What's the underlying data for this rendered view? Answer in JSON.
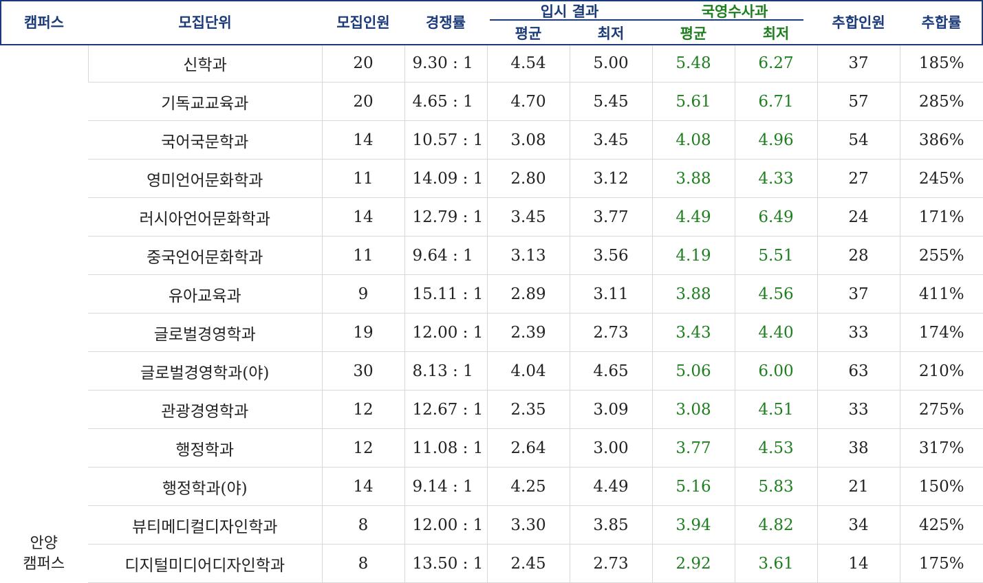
{
  "header": {
    "campus": "캠퍼스",
    "unit": "모집단위",
    "quota": "모집인원",
    "competition": "경쟁률",
    "admission_result": "입시 결과",
    "kems": "국영수사과",
    "avg": "평균",
    "min": "최저",
    "extra": "추합인원",
    "extra_rate": "추합률"
  },
  "campus": {
    "line1": "안양",
    "line2": "캠퍼스"
  },
  "rows": [
    {
      "unit": "신학과",
      "quota": "20",
      "competition": "9.30 : 1",
      "avg": "4.54",
      "min": "5.00",
      "k_avg": "5.48",
      "k_min": "6.27",
      "extra": "37",
      "rate": "185%"
    },
    {
      "unit": "기독교교육과",
      "quota": "20",
      "competition": "4.65 : 1",
      "avg": "4.70",
      "min": "5.45",
      "k_avg": "5.61",
      "k_min": "6.71",
      "extra": "57",
      "rate": "285%"
    },
    {
      "unit": "국어국문학과",
      "quota": "14",
      "competition": "10.57 : 1",
      "avg": "3.08",
      "min": "3.45",
      "k_avg": "4.08",
      "k_min": "4.96",
      "extra": "54",
      "rate": "386%"
    },
    {
      "unit": "영미언어문화학과",
      "quota": "11",
      "competition": "14.09 : 1",
      "avg": "2.80",
      "min": "3.12",
      "k_avg": "3.88",
      "k_min": "4.33",
      "extra": "27",
      "rate": "245%"
    },
    {
      "unit": "러시아언어문화학과",
      "quota": "14",
      "competition": "12.79 : 1",
      "avg": "3.45",
      "min": "3.77",
      "k_avg": "4.49",
      "k_min": "6.49",
      "extra": "24",
      "rate": "171%"
    },
    {
      "unit": "중국언어문화학과",
      "quota": "11",
      "competition": "9.64 : 1",
      "avg": "3.13",
      "min": "3.56",
      "k_avg": "4.19",
      "k_min": "5.51",
      "extra": "28",
      "rate": "255%"
    },
    {
      "unit": "유아교육과",
      "quota": "9",
      "competition": "15.11 : 1",
      "avg": "2.89",
      "min": "3.11",
      "k_avg": "3.88",
      "k_min": "4.56",
      "extra": "37",
      "rate": "411%"
    },
    {
      "unit": "글로벌경영학과",
      "quota": "19",
      "competition": "12.00 : 1",
      "avg": "2.39",
      "min": "2.73",
      "k_avg": "3.43",
      "k_min": "4.40",
      "extra": "33",
      "rate": "174%"
    },
    {
      "unit": "글로벌경영학과(야)",
      "quota": "30",
      "competition": "8.13 : 1",
      "avg": "4.04",
      "min": "4.65",
      "k_avg": "5.06",
      "k_min": "6.00",
      "extra": "63",
      "rate": "210%"
    },
    {
      "unit": "관광경영학과",
      "quota": "12",
      "competition": "12.67 : 1",
      "avg": "2.35",
      "min": "3.09",
      "k_avg": "3.08",
      "k_min": "4.51",
      "extra": "33",
      "rate": "275%"
    },
    {
      "unit": "행정학과",
      "quota": "12",
      "competition": "11.08 : 1",
      "avg": "2.64",
      "min": "3.00",
      "k_avg": "3.77",
      "k_min": "4.53",
      "extra": "38",
      "rate": "317%"
    },
    {
      "unit": "행정학과(야)",
      "quota": "14",
      "competition": "9.14 : 1",
      "avg": "4.25",
      "min": "4.49",
      "k_avg": "5.16",
      "k_min": "5.83",
      "extra": "21",
      "rate": "150%"
    },
    {
      "unit": "뷰티메디컬디자인학과",
      "quota": "8",
      "competition": "12.00 : 1",
      "avg": "3.30",
      "min": "3.85",
      "k_avg": "3.94",
      "k_min": "4.82",
      "extra": "34",
      "rate": "425%"
    },
    {
      "unit": "디지털미디어디자인학과",
      "quota": "8",
      "competition": "13.50 : 1",
      "avg": "2.45",
      "min": "2.73",
      "k_avg": "2.92",
      "k_min": "3.61",
      "extra": "14",
      "rate": "175%"
    }
  ]
}
